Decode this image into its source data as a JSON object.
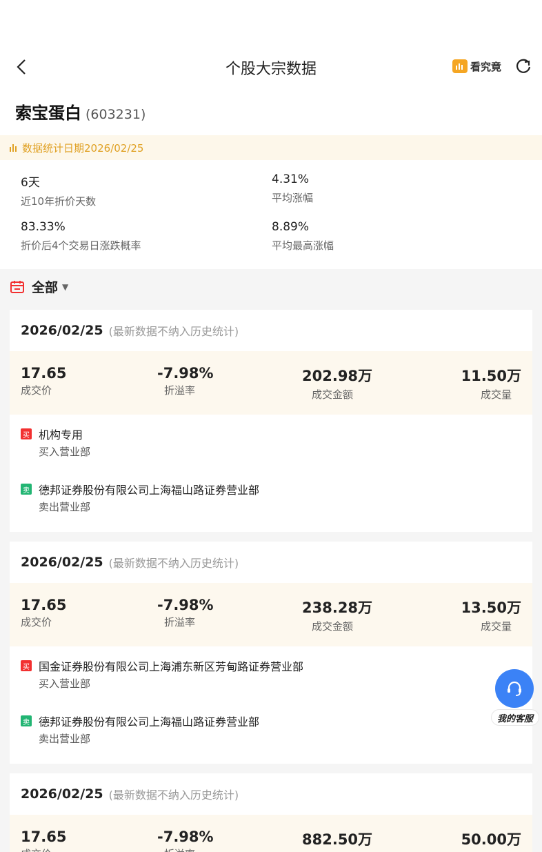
{
  "header": {
    "title": "个股大宗数据",
    "kjj_label": "看究竟"
  },
  "stock": {
    "name": "索宝蛋白",
    "code": "(603231)"
  },
  "stat_date": "数据统计日期2026/02/25",
  "summary": [
    {
      "value": "6天",
      "label": "近10年折价天数"
    },
    {
      "value": "4.31%",
      "label": "平均涨幅"
    },
    {
      "value": "83.33%",
      "label": "折价后4个交易日涨跌概率"
    },
    {
      "value": "8.89%",
      "label": "平均最高涨幅"
    }
  ],
  "filter": {
    "label": "全部",
    "caret": "▼"
  },
  "metric_labels": {
    "price": "成交价",
    "premium": "折溢率",
    "amount": "成交金额",
    "volume": "成交量"
  },
  "tags": {
    "buy": "买",
    "sell": "卖"
  },
  "colors": {
    "buy_tag": "#f23030",
    "sell_tag": "#22b573",
    "accent": "#e0a124",
    "service": "#3b82f6"
  },
  "records": [
    {
      "date": "2026/02/25",
      "note": "(最新数据不纳入历史统计)",
      "price": "17.65",
      "premium": "-7.98%",
      "amount": "202.98万",
      "volume": "11.50万",
      "buyer": {
        "name": "机构专用",
        "role": "买入营业部"
      },
      "seller": {
        "name": "德邦证券股份有限公司上海福山路证券营业部",
        "role": "卖出营业部"
      }
    },
    {
      "date": "2026/02/25",
      "note": "(最新数据不纳入历史统计)",
      "price": "17.65",
      "premium": "-7.98%",
      "amount": "238.28万",
      "volume": "13.50万",
      "buyer": {
        "name": "国金证券股份有限公司上海浦东新区芳甸路证券营业部",
        "role": "买入营业部"
      },
      "seller": {
        "name": "德邦证券股份有限公司上海福山路证券营业部",
        "role": "卖出营业部"
      }
    },
    {
      "date": "2026/02/25",
      "note": "(最新数据不纳入历史统计)",
      "price": "17.65",
      "premium": "-7.98%",
      "amount": "882.50万",
      "volume": "50.00万"
    }
  ],
  "service_label": "我的客服"
}
